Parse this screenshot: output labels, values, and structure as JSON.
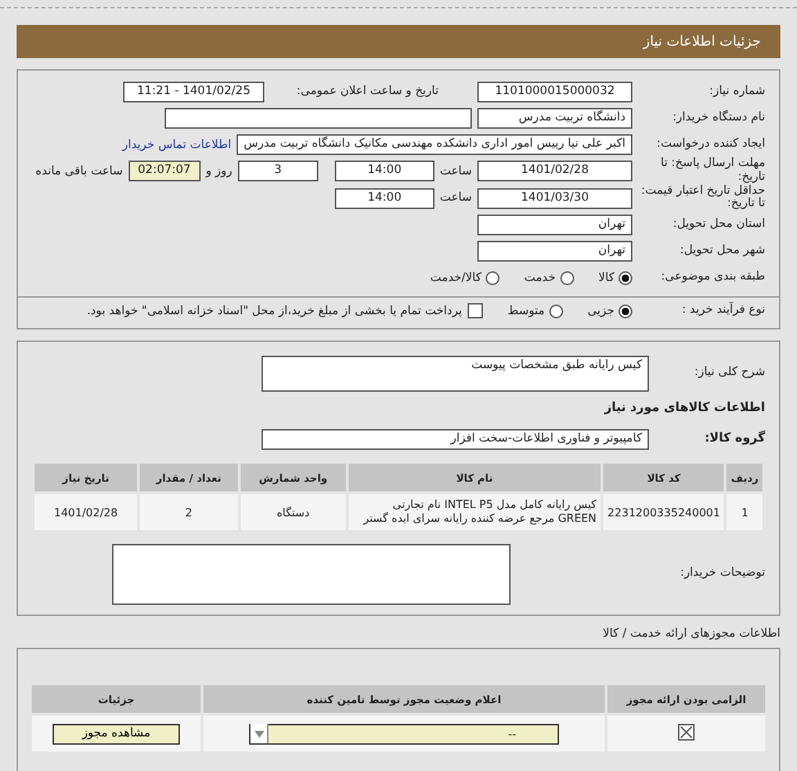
{
  "header": {
    "title": "جزئیات اطلاعات نیاز"
  },
  "need_info": {
    "need_number": {
      "label": "شماره نیاز:",
      "value": "1101000015000032"
    },
    "announce": {
      "label": "تاریخ و ساعت اعلان عمومی:",
      "value": "1401/02/25 - 11:21"
    },
    "buyer_org": {
      "label": "نام دستگاه خریدار:",
      "value": "دانشگاه تربیت مدرس"
    },
    "requester": {
      "label": "ایجاد کننده درخواست:",
      "value": "اکبر علی نیا رییس امور اداری دانشکده مهندسی مکانیک دانشگاه تربیت مدرس",
      "link": "اطلاعات تماس خریدار"
    },
    "reply_deadline": {
      "label": "مهلت ارسال پاسخ: تا تاریخ:",
      "date": "1401/02/28",
      "time_label": "ساعت",
      "time": "14:00",
      "days": "3",
      "days_label": "روز و",
      "remaining": "02:07:07",
      "remaining_label": "ساعت باقی مانده"
    },
    "price_validity": {
      "label": "حداقل تاریخ اعتبار قیمت: تا تاریخ:",
      "date": "1401/03/30",
      "time_label": "ساعت",
      "time": "14:00"
    },
    "province": {
      "label": "استان محل تحویل:",
      "value": "تهران"
    },
    "city": {
      "label": "شهر محل تحویل:",
      "value": "تهران"
    },
    "category": {
      "label": "طبقه بندی موضوعی:",
      "options": [
        {
          "label": "کالا",
          "selected": true
        },
        {
          "label": "خدمت",
          "selected": false
        },
        {
          "label": "کالا/خدمت",
          "selected": false
        }
      ]
    },
    "process": {
      "label": "نوع فرآیند خرید :",
      "options": [
        {
          "label": "جزیی",
          "selected": true
        },
        {
          "label": "متوسط",
          "selected": false
        }
      ],
      "treasury": {
        "checked": false,
        "text": "پرداخت تمام یا بخشی از مبلغ خرید،از محل \"اسناد خزانه اسلامی\" خواهد بود."
      }
    }
  },
  "goods": {
    "description": {
      "label": "شرح کلی نیاز:",
      "value": "کیس رایانه طبق مشخصات پیوست"
    },
    "heading": "اطلاعات کالاهای مورد نیاز",
    "group": {
      "label": "گروه کالا:",
      "value": "کامپیوتر و فناوری اطلاعات-سخت افزار"
    },
    "table": {
      "columns": [
        "ردیف",
        "کد کالا",
        "نام کالا",
        "واحد شمارش",
        "تعداد / مقدار",
        "تاریخ نیاز"
      ],
      "rows": [
        [
          "1",
          "2231200335240001",
          "کیس رایانه کامل مدل INTEL P5 نام تجارتی GREEN مرجع عرضه کننده رایانه سرای ایده گستر",
          "دستگاه",
          "2",
          "1401/02/28"
        ]
      ]
    },
    "buyer_notes": {
      "label": "توضیحات خریدار:"
    }
  },
  "permits": {
    "heading": "اطلاعات مجوزهای ارائه خدمت / کالا",
    "columns": [
      "الزامی بودن ارائه مجوز",
      "اعلام وضعیت مجوز توسط تامین کننده",
      "جزئیات"
    ],
    "rows": [
      {
        "required": true,
        "status": "--",
        "button": "مشاهده مجوز"
      }
    ]
  }
}
